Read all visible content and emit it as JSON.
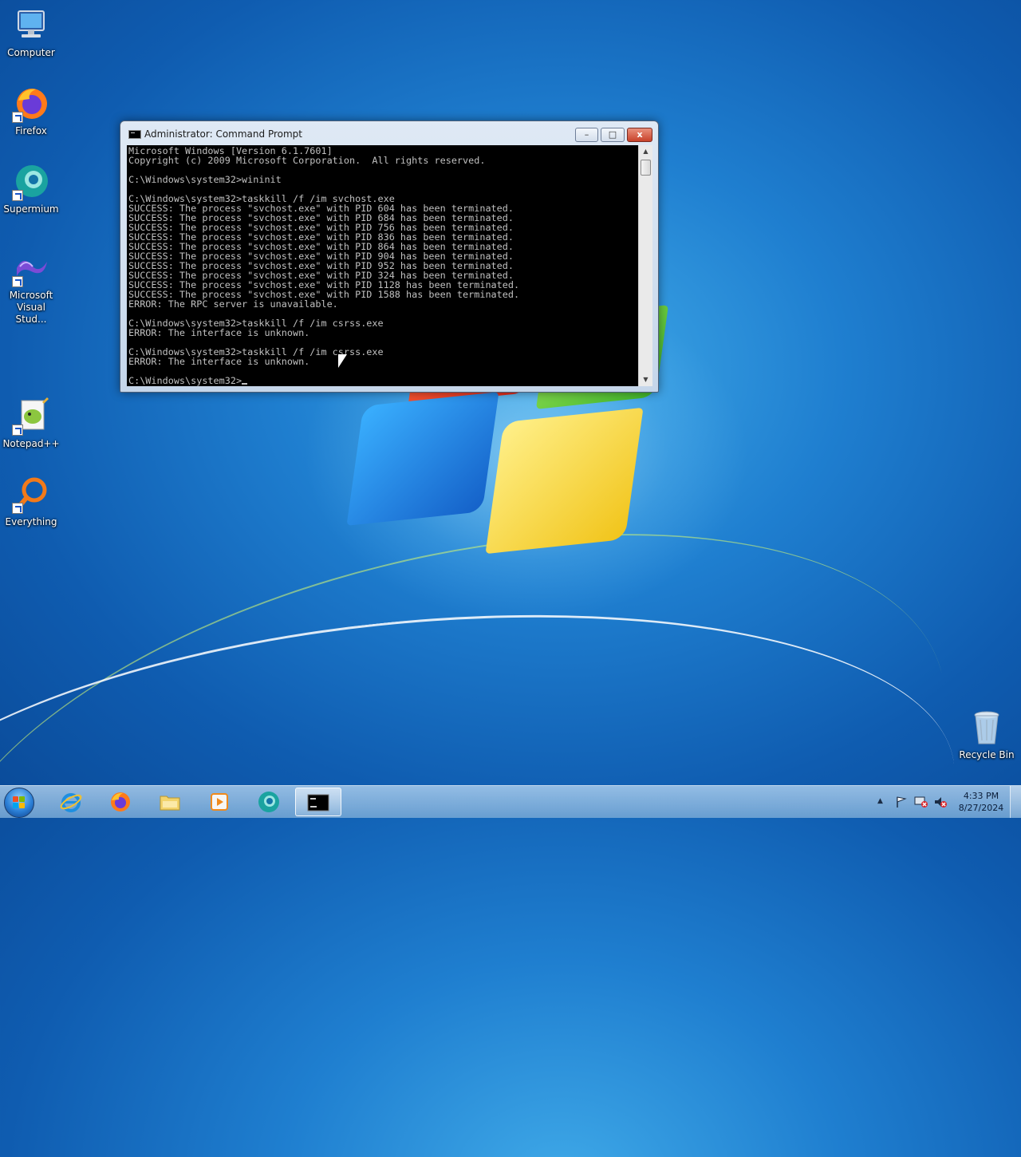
{
  "desktop": {
    "icons": [
      {
        "label": "Computer"
      },
      {
        "label": "Firefox"
      },
      {
        "label": "Supermium"
      },
      {
        "label": "Microsoft Visual Stud..."
      },
      {
        "label": "Notepad++"
      },
      {
        "label": "Everything"
      },
      {
        "label": "Recycle Bin"
      }
    ]
  },
  "cmd_window": {
    "title": "Administrator: Command Prompt",
    "minimize_label": "–",
    "maximize_label": "□",
    "close_label": "x",
    "console_text": "Microsoft Windows [Version 6.1.7601]\nCopyright (c) 2009 Microsoft Corporation.  All rights reserved.\n\nC:\\Windows\\system32>wininit\n\nC:\\Windows\\system32>taskkill /f /im svchost.exe\nSUCCESS: The process \"svchost.exe\" with PID 604 has been terminated.\nSUCCESS: The process \"svchost.exe\" with PID 684 has been terminated.\nSUCCESS: The process \"svchost.exe\" with PID 756 has been terminated.\nSUCCESS: The process \"svchost.exe\" with PID 836 has been terminated.\nSUCCESS: The process \"svchost.exe\" with PID 864 has been terminated.\nSUCCESS: The process \"svchost.exe\" with PID 904 has been terminated.\nSUCCESS: The process \"svchost.exe\" with PID 952 has been terminated.\nSUCCESS: The process \"svchost.exe\" with PID 324 has been terminated.\nSUCCESS: The process \"svchost.exe\" with PID 1128 has been terminated.\nSUCCESS: The process \"svchost.exe\" with PID 1588 has been terminated.\nERROR: The RPC server is unavailable.\n\nC:\\Windows\\system32>taskkill /f /im csrss.exe\nERROR: The interface is unknown.\n\nC:\\Windows\\system32>taskkill /f /im csrss.exe\nERROR: The interface is unknown.\n\n",
    "prompt": "C:\\Windows\\system32>"
  },
  "taskbar": {
    "pinned": [
      "internet-explorer",
      "firefox",
      "file-explorer",
      "media-player",
      "supermium",
      "command-prompt"
    ],
    "active": "command-prompt",
    "tray": {
      "time": "4:33 PM",
      "date": "8/27/2024"
    }
  },
  "colors": {
    "console_bg": "#000000",
    "console_fg": "#c0c0c0",
    "close_button": "#c8422a"
  }
}
